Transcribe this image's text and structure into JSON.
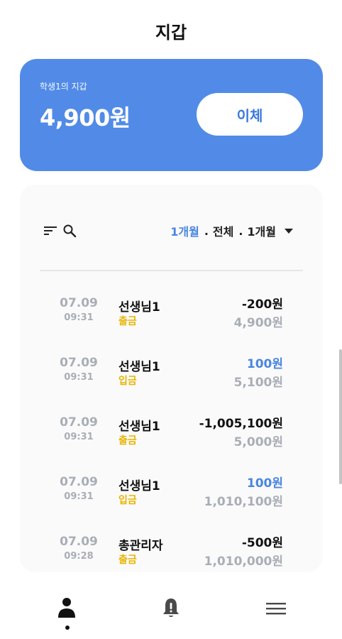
{
  "header": {
    "title": "지갑"
  },
  "wallet": {
    "owner_label": "학생1의 지갑",
    "balance": "4,900원",
    "transfer_label": "이체"
  },
  "filter": {
    "active_period": "1개월",
    "separator": ".",
    "type_label": "전체",
    "period_label": "1개월",
    "icons": [
      "sort-icon",
      "search-icon",
      "caret-down-icon"
    ]
  },
  "transactions": [
    {
      "date": "07.09",
      "time": "09:31",
      "name": "선생님1",
      "type": "출금",
      "amount": "-200원",
      "balance": "4,900원"
    },
    {
      "date": "07.09",
      "time": "09:31",
      "name": "선생님1",
      "type": "입금",
      "amount": "100원",
      "balance": "5,100원"
    },
    {
      "date": "07.09",
      "time": "09:31",
      "name": "선생님1",
      "type": "출금",
      "amount": "-1,005,100원",
      "balance": "5,000원"
    },
    {
      "date": "07.09",
      "time": "09:31",
      "name": "선생님1",
      "type": "입금",
      "amount": "100원",
      "balance": "1,010,100원"
    },
    {
      "date": "07.09",
      "time": "09:28",
      "name": "총관리자",
      "type": "출금",
      "amount": "-500원",
      "balance": "1,010,000원"
    }
  ],
  "bottom_nav": {
    "items": [
      {
        "icon": "person-icon",
        "active": true
      },
      {
        "icon": "bell-alert-icon",
        "active": false
      },
      {
        "icon": "menu-icon",
        "active": false
      }
    ]
  },
  "colors": {
    "accent": "#528be7",
    "deposit": "#4a86e0",
    "withdraw_type": "#e8b400",
    "muted": "#a9aeb6"
  }
}
